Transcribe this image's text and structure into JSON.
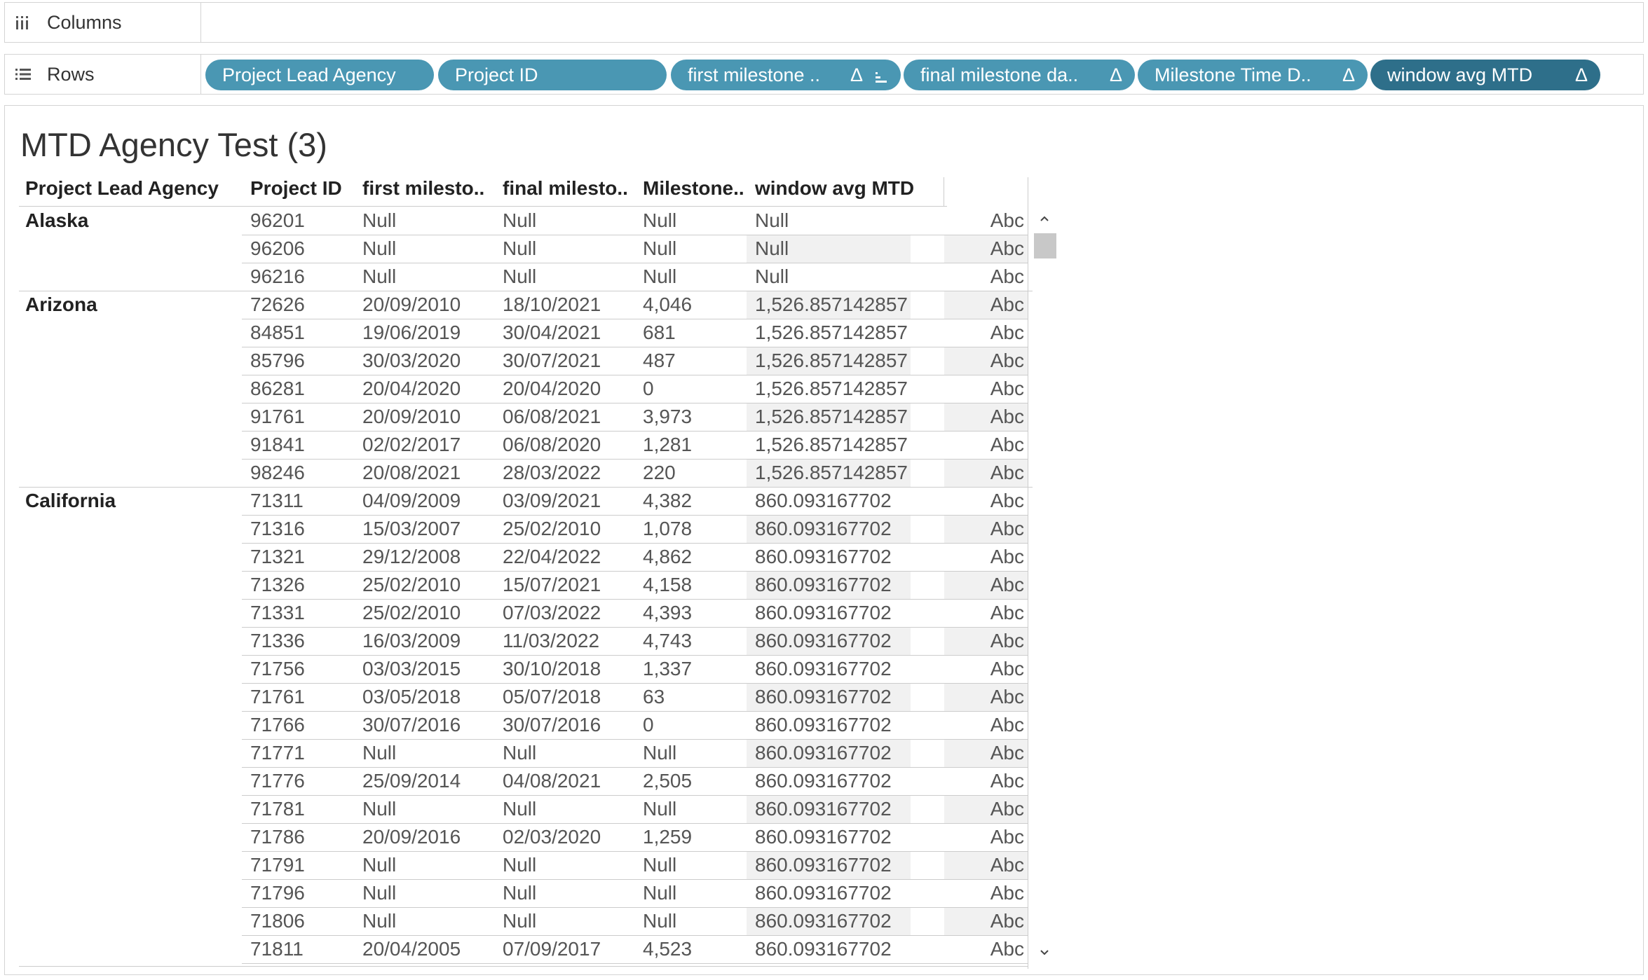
{
  "shelves": {
    "columns_label": "Columns",
    "rows_label": "Rows",
    "rows_pills": [
      {
        "label": "Project Lead Agency",
        "delta": ""
      },
      {
        "label": "Project ID",
        "delta": ""
      },
      {
        "label": "first milestone ..",
        "delta": "Δ"
      },
      {
        "label": "final milestone da..",
        "delta": "Δ"
      },
      {
        "label": "Milestone Time D..",
        "delta": "Δ"
      },
      {
        "label": "window avg MTD",
        "delta": "Δ"
      }
    ]
  },
  "sheet": {
    "title": "MTD Agency Test (3)",
    "headers": [
      "Project Lead Agency",
      "Project ID",
      "first milesto..",
      "final milesto..",
      "Milestone..",
      "window avg MTD"
    ],
    "groups": [
      {
        "agency": "Alaska",
        "rows": [
          [
            "96201",
            "Null",
            "Null",
            "Null",
            "Null",
            "Abc"
          ],
          [
            "96206",
            "Null",
            "Null",
            "Null",
            "Null",
            "Abc"
          ],
          [
            "96216",
            "Null",
            "Null",
            "Null",
            "Null",
            "Abc"
          ]
        ]
      },
      {
        "agency": "Arizona",
        "rows": [
          [
            "72626",
            "20/09/2010",
            "18/10/2021",
            "4,046",
            "1,526.857142857",
            "Abc"
          ],
          [
            "84851",
            "19/06/2019",
            "30/04/2021",
            "681",
            "1,526.857142857",
            "Abc"
          ],
          [
            "85796",
            "30/03/2020",
            "30/07/2021",
            "487",
            "1,526.857142857",
            "Abc"
          ],
          [
            "86281",
            "20/04/2020",
            "20/04/2020",
            "0",
            "1,526.857142857",
            "Abc"
          ],
          [
            "91761",
            "20/09/2010",
            "06/08/2021",
            "3,973",
            "1,526.857142857",
            "Abc"
          ],
          [
            "91841",
            "02/02/2017",
            "06/08/2020",
            "1,281",
            "1,526.857142857",
            "Abc"
          ],
          [
            "98246",
            "20/08/2021",
            "28/03/2022",
            "220",
            "1,526.857142857",
            "Abc"
          ]
        ]
      },
      {
        "agency": "California",
        "rows": [
          [
            "71311",
            "04/09/2009",
            "03/09/2021",
            "4,382",
            "860.093167702",
            "Abc"
          ],
          [
            "71316",
            "15/03/2007",
            "25/02/2010",
            "1,078",
            "860.093167702",
            "Abc"
          ],
          [
            "71321",
            "29/12/2008",
            "22/04/2022",
            "4,862",
            "860.093167702",
            "Abc"
          ],
          [
            "71326",
            "25/02/2010",
            "15/07/2021",
            "4,158",
            "860.093167702",
            "Abc"
          ],
          [
            "71331",
            "25/02/2010",
            "07/03/2022",
            "4,393",
            "860.093167702",
            "Abc"
          ],
          [
            "71336",
            "16/03/2009",
            "11/03/2022",
            "4,743",
            "860.093167702",
            "Abc"
          ],
          [
            "71756",
            "03/03/2015",
            "30/10/2018",
            "1,337",
            "860.093167702",
            "Abc"
          ],
          [
            "71761",
            "03/05/2018",
            "05/07/2018",
            "63",
            "860.093167702",
            "Abc"
          ],
          [
            "71766",
            "30/07/2016",
            "30/07/2016",
            "0",
            "860.093167702",
            "Abc"
          ],
          [
            "71771",
            "Null",
            "Null",
            "Null",
            "860.093167702",
            "Abc"
          ],
          [
            "71776",
            "25/09/2014",
            "04/08/2021",
            "2,505",
            "860.093167702",
            "Abc"
          ],
          [
            "71781",
            "Null",
            "Null",
            "Null",
            "860.093167702",
            "Abc"
          ],
          [
            "71786",
            "20/09/2016",
            "02/03/2020",
            "1,259",
            "860.093167702",
            "Abc"
          ],
          [
            "71791",
            "Null",
            "Null",
            "Null",
            "860.093167702",
            "Abc"
          ],
          [
            "71796",
            "Null",
            "Null",
            "Null",
            "860.093167702",
            "Abc"
          ],
          [
            "71806",
            "Null",
            "Null",
            "Null",
            "860.093167702",
            "Abc"
          ],
          [
            "71811",
            "20/04/2005",
            "07/09/2017",
            "4,523",
            "860.093167702",
            "Abc"
          ]
        ]
      }
    ]
  },
  "colors": {
    "pill": "#4a97b3",
    "pill_selected": "#2e6f8a",
    "grid_line": "#cccccc",
    "shaded_cell": "#f1f1f1"
  }
}
